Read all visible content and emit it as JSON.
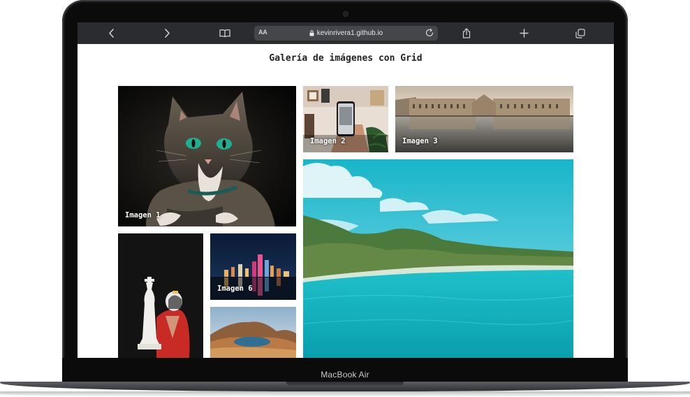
{
  "browser": {
    "back_icon": "chevron-left-icon",
    "forward_icon": "chevron-right-icon",
    "bookmarks_icon": "open-book-icon",
    "reader_label": "AA",
    "url": "kevinrivera1.github.io",
    "share_icon": "share-icon",
    "new_tab_icon": "plus-icon",
    "tabs_icon": "tabs-icon"
  },
  "page": {
    "title": "Galería de imágenes con Grid"
  },
  "gallery": {
    "items": [
      {
        "caption": "Imagen 1",
        "subject": "cat"
      },
      {
        "caption": "Imagen 2",
        "subject": "phone-in-hand"
      },
      {
        "caption": "Imagen 3",
        "subject": "city-reflection"
      },
      {
        "caption": "",
        "subject": "tropical-coast"
      },
      {
        "caption": "",
        "subject": "chess-portrait"
      },
      {
        "caption": "Imagen 6",
        "subject": "city-night"
      },
      {
        "caption": "",
        "subject": "crater-lake"
      }
    ]
  },
  "device": {
    "label": "MacBook Air"
  }
}
